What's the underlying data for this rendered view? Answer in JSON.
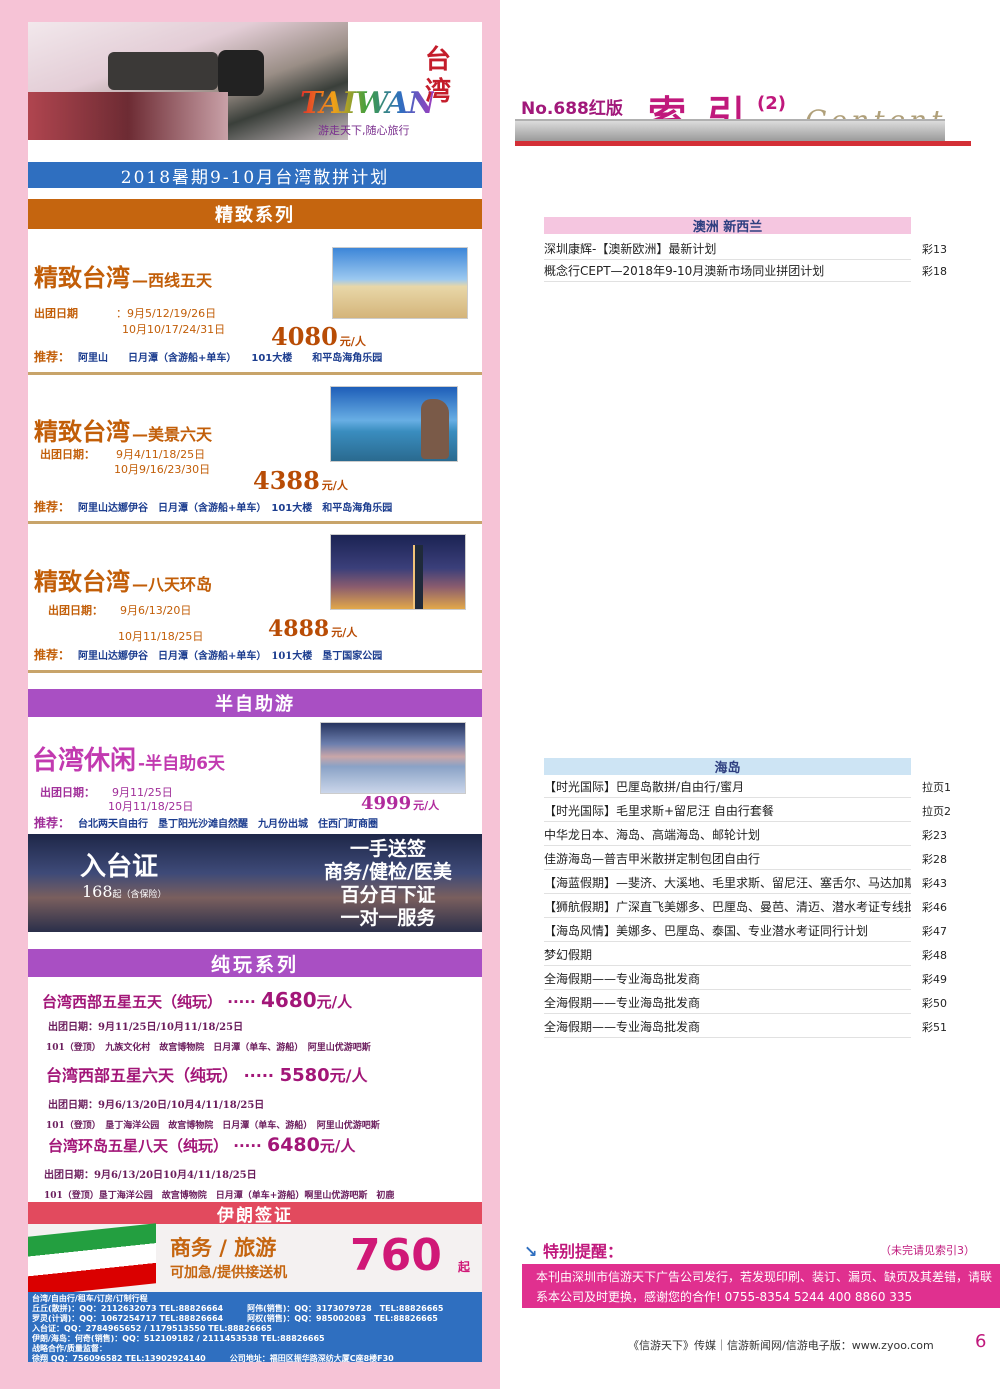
{
  "issue": "No.688红版",
  "index_title": "索 引",
  "index_num": "(2)",
  "content_word": "Content",
  "logo": {
    "script": "TAIWAN",
    "cn": "台湾",
    "slogan": "游走天下,随心旅行"
  },
  "plan_banner": "2018暑期9-10月台湾散拼计划",
  "sec_jingzhi": "精致系列",
  "products": [
    {
      "title": "精致台湾",
      "sub": "—西线五天",
      "date_label": "出团日期",
      "dates1": "：9月5/12/19/26日",
      "dates2": "10月10/17/24/31日",
      "price": "4080",
      "unit": "元/人",
      "rec_label": "推荐：",
      "rec": "阿里山　　日月潭（含游船+单车）　　101大楼　　和平岛海角乐园"
    },
    {
      "title": "精致台湾",
      "sub": "—美景六天",
      "date_label": "出团日期：",
      "dates1": "9月4/11/18/25日",
      "dates2": "10月9/16/23/30日",
      "price": "4388",
      "unit": "元/人",
      "rec_label": "推荐：",
      "rec": "阿里山达娜伊谷　日月潭（含游船+单车）　101大楼　和平岛海角乐园"
    },
    {
      "title": "精致台湾",
      "sub": "—八天环岛",
      "date_label": "出团日期：",
      "dates1": "9月6/13/20日",
      "dates2": "10月11/18/25日",
      "price": "4888",
      "unit": "元/人",
      "rec_label": "推荐：",
      "rec": "阿里山达娜伊谷　日月潭（含游船+单车）　101大楼　垦丁国家公园"
    }
  ],
  "sec_semi": "半自助游",
  "semi": {
    "title": "台湾休闲",
    "sub": "-半自助6天",
    "date_label": "出团日期：",
    "dates1": "9月11/25日",
    "dates2": "10月11/18/25日",
    "price": "4999",
    "unit": "元/人",
    "rec_label": "推荐：",
    "rec": "台北两天自由行　垦丁阳光沙滩自然醒　九月份出城　住西门町商圈"
  },
  "permit": {
    "title": "入台证",
    "price": "168",
    "note": "起（含保险）",
    "lines": [
      "一手送签",
      "商务/健检/医美",
      "百分百下证",
      "一对一服务"
    ]
  },
  "sec_pure": "纯玩系列",
  "pure": [
    {
      "title": "台湾西部五星五天（纯玩）",
      "dots": "·····",
      "price": "4680",
      "unit": "元/人",
      "dates": "出团日期：9月11/25日/10月11/18/25日",
      "rec": "101（登顶）　九族文化村　故宫博物院　日月潭（单车、游船）　阿里山优游吧斯"
    },
    {
      "title": "台湾西部五星六天（纯玩）",
      "dots": "·····",
      "price": "5580",
      "unit": "元/人",
      "dates": "出团日期：9月6/13/20日/10月4/11/18/25日",
      "rec": "101（登顶）　垦丁海洋公园　故宫博物院　日月潭（单车、游船）　阿里山优游吧斯"
    },
    {
      "title": "台湾环岛五星八天（纯玩）",
      "dots": "·····",
      "price": "6480",
      "unit": "元/人",
      "dates": "出团日期：9月6/13/20日10月4/11/18/25日",
      "rec": "101（登顶）垦丁海洋公园　故宫博物院　日月潭（单车+游船）啊里山优游吧斯　初鹿"
    }
  ],
  "sec_iran": "伊朗签证",
  "iran": {
    "text1": "商务 / 旅游",
    "text2": "可加急/提供接送机",
    "price": "760",
    "unit": "起"
  },
  "contacts": [
    "台湾/自由行/租车/订房/订制行程",
    "丘丘(散拼)：QQ：2112632073  TEL:88826664　　　阿伟(销售)：QQ：3173079728　TEL:88826665",
    "罗灵(计调)：QQ：1067254717  TEL:88826664　　　阿权(销售)：QQ：985002083　TEL:88826665",
    "入台证：QQ：2784965652 / 1179513550  TEL:88826665",
    "伊朗/海岛：何奇(销售)：QQ：512109182 / 2111453538  TEL:88826665",
    "战略合作/质量监督：",
    "徐翔  QQ：756096582  TEL:13902924140　　　公司地址：福田区振华路深纺大厦C座8楼F30"
  ],
  "aus": {
    "title": "澳洲  新西兰",
    "rows": [
      {
        "name": "深圳康辉-【澳新欧洲】最新计划",
        "page": "彩13"
      },
      {
        "name": "概念行CEPT—2018年9-10月澳新市场同业拼团计划",
        "page": "彩18"
      }
    ]
  },
  "island": {
    "title": "海岛",
    "rows": [
      {
        "name": "【时光国际】巴厘岛散拼/自由行/蜜月",
        "page": "拉页1"
      },
      {
        "name": "【时光国际】毛里求斯+留尼汪 自由行套餐",
        "page": "拉页2"
      },
      {
        "name": "中华龙日本、海岛、高端海岛、邮轮计划",
        "page": "彩23"
      },
      {
        "name": "佳游海岛—普吉甲米散拼定制包团自由行",
        "page": "彩28"
      },
      {
        "name": "【海蓝假期】—斐济、大溪地、毛里求斯、留尼汪、塞舌尔、马达加斯加专线",
        "page": "彩43"
      },
      {
        "name": "【狮航假期】广深直飞美娜多、巴厘岛、曼芭、清迈、潜水考证专线批发商",
        "page": "彩46"
      },
      {
        "name": "【海岛风情】美娜多、巴厘岛、泰国、专业潜水考证同行计划",
        "page": "彩47"
      },
      {
        "name": "梦幻假期",
        "page": "彩48"
      },
      {
        "name": "全海假期——专业海岛批发商",
        "page": "彩49"
      },
      {
        "name": "全海假期——专业海岛批发商",
        "page": "彩50"
      },
      {
        "name": "全海假期——专业海岛批发商",
        "page": "彩51"
      }
    ]
  },
  "notice": {
    "title": "特别提醒：",
    "note": "（未完请见索引3）",
    "body": "本刊由深圳市信游天下广告公司发行，若发现印刷、装订、漏页、缺页及其差错，请联系本公司及时更换，感谢您的合作!   0755-8354 5244    400 8860 335"
  },
  "footer": "《信游天下》传媒｜信游新闻网/信游电子版：www.zyoo.com",
  "page_num": "6",
  "colors": {
    "blue": "#2f6fc0",
    "orange": "#c5650f",
    "purple": "#a94fc3",
    "magenta": "#d8338e",
    "pink": "#f6c3d6",
    "red": "#d32f36"
  }
}
